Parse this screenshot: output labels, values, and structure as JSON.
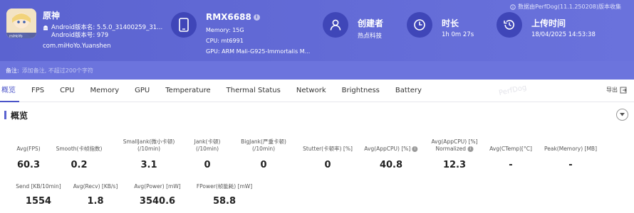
{
  "app": {
    "name": "原神",
    "android_version": "Android版本名: 5.5.0_31400259_31...",
    "android_code": "Android版本号: 979",
    "package": "com.miHoYo.Yuanshen",
    "icon": "app-icon-genshin"
  },
  "device": {
    "name": "RMX6688",
    "info_badge": "i",
    "memory": "Memory: 15G",
    "cpu": "CPU: mt6991",
    "gpu": "GPU: ARM Mali-G925-Immortalis M..."
  },
  "creator": {
    "title": "创建者",
    "value": "热点科技"
  },
  "duration": {
    "title": "时长",
    "value": "1h 0m 27s"
  },
  "upload": {
    "title": "上传时间",
    "value": "18/04/2025 14:53:38"
  },
  "collect_note": "数据由PerfDog(11.1.250208)版本收集",
  "remark": {
    "label": "备注:",
    "placeholder": "添加备注, 不超过200个字符"
  },
  "tabs": [
    "概览",
    "FPS",
    "CPU",
    "Memory",
    "GPU",
    "Temperature",
    "Thermal Status",
    "Network",
    "Brightness",
    "Battery"
  ],
  "active_tab": "概览",
  "watermark": "PerfDog",
  "export_label": "导出",
  "section": {
    "title": "概览"
  },
  "metrics_row1": [
    {
      "label": "Avg(FPS)",
      "value": "60.3"
    },
    {
      "label": "Smooth(卡帧指数)",
      "value": "0.2"
    },
    {
      "label": "SmallJank(微小卡顿)\n(/10min)",
      "value": "3.1"
    },
    {
      "label": "Jank(卡顿)\n(/10min)",
      "value": "0"
    },
    {
      "label": "BigJank(严重卡顿)\n(/10min)",
      "value": "0"
    },
    {
      "label": "Stutter(卡顿率) [%]",
      "value": "0"
    },
    {
      "label": "Avg(AppCPU) [%]",
      "value": "40.8"
    },
    {
      "label": "Avg(AppCPU) [%]\nNormalized",
      "value": "12.3"
    },
    {
      "label": "Avg(CTemp)[°C]",
      "value": "-"
    },
    {
      "label": "Peak(Memory) [MB]",
      "value": "-"
    }
  ],
  "metrics_row2": [
    {
      "label": "Send [KB/10min]",
      "value": "1554"
    },
    {
      "label": "Avg(Recv) [KB/s]",
      "value": "1.8"
    },
    {
      "label": "Avg(Power) [mW]",
      "value": "3540.6"
    },
    {
      "label": "FPower(帧能耗) [mW]",
      "value": "58.8"
    }
  ]
}
